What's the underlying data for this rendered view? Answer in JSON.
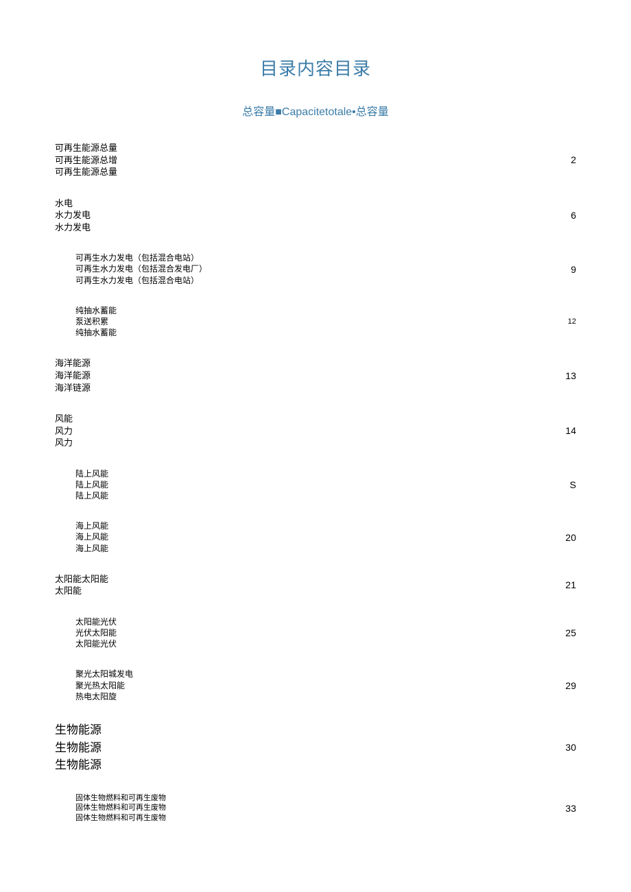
{
  "title": "目录内容目录",
  "subtitle": "总容量■Capacitetotale•总容量",
  "entries": [
    {
      "level": 0,
      "lineClass": "toc-line",
      "pageClass": "toc-page",
      "lines": [
        "可再生能源总量",
        "可再生能源总增",
        "可再生能源总量"
      ],
      "page": "2"
    },
    {
      "level": 0,
      "lineClass": "toc-line",
      "pageClass": "toc-page",
      "lines": [
        "水电",
        "水力发电",
        "水力发电"
      ],
      "page": "6"
    },
    {
      "level": 1,
      "lineClass": "toc-line small",
      "pageClass": "toc-page",
      "lines": [
        "可再生水力发电（包括混合电站）",
        "可再生水力发电（包括混合发电厂）",
        "可再生水力发电（包括混合电站）"
      ],
      "page": "9"
    },
    {
      "level": 1,
      "lineClass": "toc-line small",
      "pageClass": "toc-page small",
      "lines": [
        "纯抽水蓄能",
        "泵送积累",
        "纯抽水蓄能"
      ],
      "page": "12"
    },
    {
      "level": 0,
      "lineClass": "toc-line",
      "pageClass": "toc-page",
      "lines": [
        "海洋能源",
        "海洋能源",
        "海洋链源"
      ],
      "page": "13"
    },
    {
      "level": 0,
      "lineClass": "toc-line",
      "pageClass": "toc-page",
      "lines": [
        "风能",
        "风力",
        "风力"
      ],
      "page": "14"
    },
    {
      "level": 1,
      "lineClass": "toc-line small",
      "pageClass": "toc-page",
      "lines": [
        "陆上风能",
        "陆上风能",
        "陆上风能"
      ],
      "page": "S"
    },
    {
      "level": 1,
      "lineClass": "toc-line small",
      "pageClass": "toc-page",
      "lines": [
        "海上风能",
        "海上风能",
        "海上风能"
      ],
      "page": "20"
    },
    {
      "level": 0,
      "lineClass": "toc-line",
      "pageClass": "toc-page",
      "lines": [
        "太阳能太阳能",
        "太阳能"
      ],
      "page": "21"
    },
    {
      "level": 1,
      "lineClass": "toc-line small",
      "pageClass": "toc-page",
      "lines": [
        "太阳能光伏",
        "光伏太阳能",
        "太阳能光伏"
      ],
      "page": "25"
    },
    {
      "level": 1,
      "lineClass": "toc-line small",
      "pageClass": "toc-page",
      "lines": [
        "聚光太阳城发电",
        "聚光热太阳能",
        "热电太阳旋"
      ],
      "page": "29"
    },
    {
      "level": 0,
      "lineClass": "toc-line large",
      "pageClass": "toc-page",
      "lines": [
        "生物能源",
        "生物能源",
        "生物能源"
      ],
      "page": "30"
    },
    {
      "level": 1,
      "lineClass": "toc-line xsmall",
      "pageClass": "toc-page",
      "lines": [
        "固体生物燃料和可再生废物",
        "固体生物燃料和可再生废物",
        "固体生物燃料和可再生废物"
      ],
      "page": "33"
    }
  ]
}
